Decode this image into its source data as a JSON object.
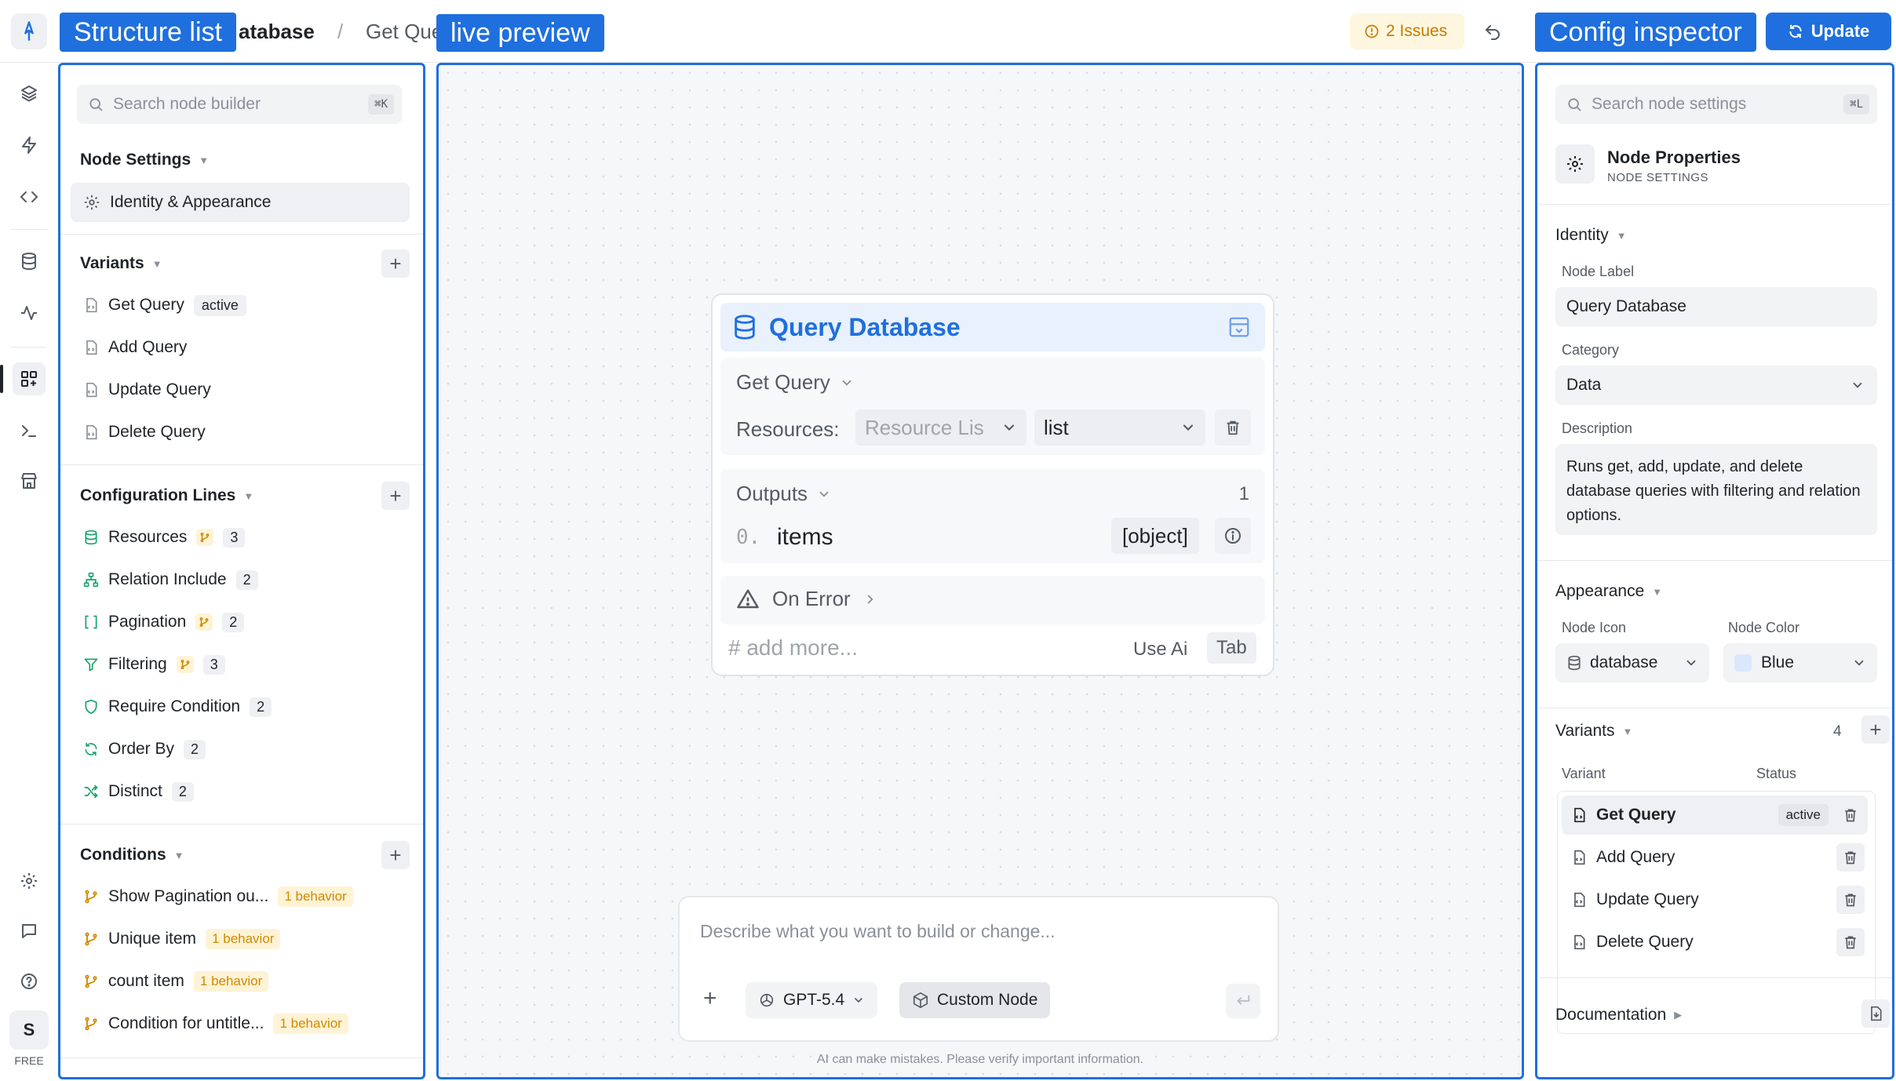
{
  "overlay_labels": {
    "structure": "Structure list",
    "preview": "live preview",
    "inspector": "Config inspector"
  },
  "header": {
    "breadcrumb_node": "atabase",
    "breadcrumb_sep": "/",
    "breadcrumb_variant": "Get Que",
    "issues": "2 Issues",
    "update": "Update"
  },
  "rail": {
    "plan": "FREE",
    "avatar": "S"
  },
  "left": {
    "search_placeholder": "Search node builder",
    "search_shortcut": "⌘K",
    "node_settings": {
      "title": "Node Settings",
      "items": [
        "Identity & Appearance"
      ]
    },
    "variants": {
      "title": "Variants",
      "items": [
        {
          "label": "Get Query",
          "badge": "active"
        },
        {
          "label": "Add Query"
        },
        {
          "label": "Update Query"
        },
        {
          "label": "Delete Query"
        }
      ]
    },
    "config_lines": {
      "title": "Configuration Lines",
      "items": [
        {
          "label": "Resources",
          "count": "3"
        },
        {
          "label": "Relation Include",
          "count": "2"
        },
        {
          "label": "Pagination",
          "count": "2"
        },
        {
          "label": "Filtering",
          "count": "3"
        },
        {
          "label": "Require Condition",
          "count": "2"
        },
        {
          "label": "Order By",
          "count": "2"
        },
        {
          "label": "Distinct",
          "count": "2"
        }
      ]
    },
    "conditions": {
      "title": "Conditions",
      "items": [
        {
          "label": "Show Pagination ou...",
          "badge": "1 behavior"
        },
        {
          "label": "Unique item",
          "badge": "1 behavior"
        },
        {
          "label": "count item",
          "badge": "1 behavior"
        },
        {
          "label": "Condition for untitle...",
          "badge": "1 behavior"
        }
      ]
    }
  },
  "node": {
    "title": "Query Database",
    "variant": "Get Query",
    "resources_label": "Resources:",
    "resources_placeholder": "Resource Lis",
    "resources_mode": "list",
    "outputs_label": "Outputs",
    "outputs_count": "1",
    "output_index": "0.",
    "output_name": "items",
    "output_type": "[object]",
    "on_error": "On Error",
    "add_more": "# add more...",
    "use_ai": "Use Ai",
    "tab": "Tab"
  },
  "chat": {
    "placeholder": "Describe what you want to build or change...",
    "model": "GPT-5.4",
    "mode": "Custom Node",
    "disclaimer": "AI can make mistakes. Please verify important information."
  },
  "right": {
    "search_placeholder": "Search node settings",
    "search_shortcut": "⌘L",
    "props_title": "Node Properties",
    "props_subtitle": "NODE SETTINGS",
    "identity_title": "Identity",
    "node_label_label": "Node Label",
    "node_label_value": "Query Database",
    "category_label": "Category",
    "category_value": "Data",
    "description_label": "Description",
    "description_value": "Runs get, add, update, and delete database queries with filtering and relation options.",
    "appearance_title": "Appearance",
    "icon_label": "Node Icon",
    "icon_value": "database",
    "color_label": "Node Color",
    "color_value": "Blue",
    "variants_title": "Variants",
    "variants_count": "4",
    "col_variant": "Variant",
    "col_status": "Status",
    "variants": [
      {
        "label": "Get Query",
        "status": "active"
      },
      {
        "label": "Add Query"
      },
      {
        "label": "Update Query"
      },
      {
        "label": "Delete Query"
      }
    ],
    "documentation": "Documentation"
  },
  "colors": {
    "accent": "#1f6fde",
    "warning": "#d08a00",
    "success": "#17a36b"
  }
}
